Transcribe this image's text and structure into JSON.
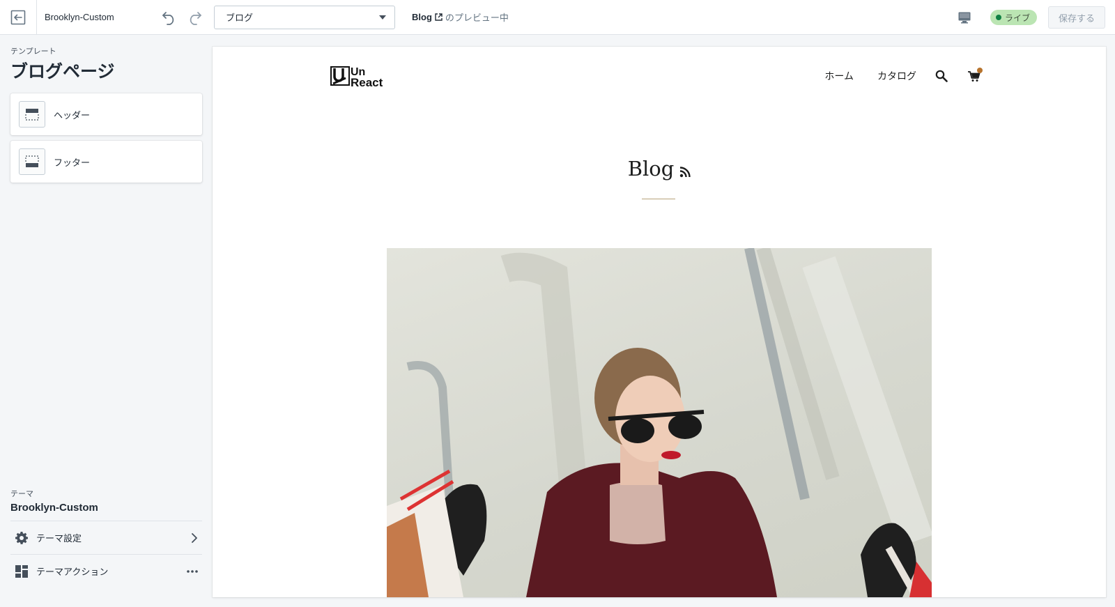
{
  "topbar": {
    "theme_name": "Brooklyn-Custom",
    "page_select": {
      "selected": "ブログ"
    },
    "preview": {
      "page": "Blog",
      "suffix": "のプレビュー中"
    },
    "live_label": "ライブ",
    "save_label": "保存する"
  },
  "sidebar": {
    "template_label": "テンプレート",
    "template_title": "ブログページ",
    "sections": [
      {
        "label": "ヘッダー",
        "icon": "header-layout-icon"
      },
      {
        "label": "フッター",
        "icon": "footer-layout-icon"
      }
    ],
    "theme_label": "テーマ",
    "theme_name": "Brooklyn-Custom",
    "menu": [
      {
        "label": "テーマ設定",
        "icon": "gear-icon"
      },
      {
        "label": "テーマアクション",
        "icon": "theme-actions-icon"
      }
    ]
  },
  "storefront": {
    "logo_text_top": "Un",
    "logo_text_bottom": "React",
    "nav": [
      "ホーム",
      "カタログ"
    ],
    "blog_title": "Blog"
  },
  "colors": {
    "live_badge_bg": "#bbe5b3",
    "live_dot": "#108043",
    "cart_dot": "#b7742e",
    "divider_accent": "#b7a27a"
  }
}
